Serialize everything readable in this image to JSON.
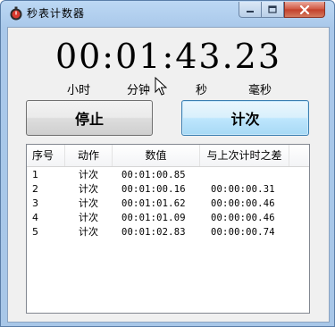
{
  "window": {
    "title": "秒表计数器",
    "controls": {
      "minimize": "minimize",
      "maximize": "maximize",
      "close": "close"
    }
  },
  "timer": {
    "display": "00:01:43.23",
    "units": {
      "hour": "小时",
      "minute": "分钟",
      "second": "秒",
      "millisecond": "毫秒"
    }
  },
  "buttons": {
    "stop": "停止",
    "lap": "计次"
  },
  "list": {
    "headers": [
      "序号",
      "动作",
      "数值",
      "与上次计时之差"
    ],
    "rows": [
      [
        "1",
        "计次",
        "00:01:00.85",
        ""
      ],
      [
        "2",
        "计次",
        "00:01:00.16",
        "00:00:00.31"
      ],
      [
        "3",
        "计次",
        "00:01:01.62",
        "00:00:00.46"
      ],
      [
        "4",
        "计次",
        "00:01:01.09",
        "00:00:00.46"
      ],
      [
        "5",
        "计次",
        "00:01:02.83",
        "00:00:00.74"
      ]
    ]
  },
  "colors": {
    "titlebar": "#a9c8ea",
    "close_button": "#c8462f",
    "lap_button_border": "#3c7fb1"
  },
  "icons": {
    "app": "stopwatch-icon",
    "cursor": "mouse-pointer-icon"
  }
}
